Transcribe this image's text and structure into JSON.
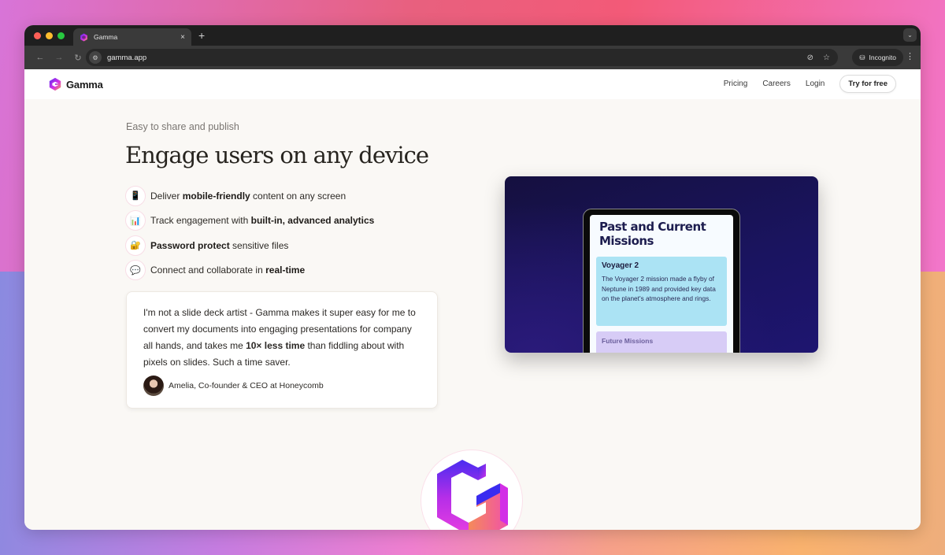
{
  "browser": {
    "tab": {
      "title": "Gamma",
      "favicon": "gamma-logo-icon",
      "close_icon": "×"
    },
    "new_tab_icon": "+",
    "tab_menu_icon": "⌄",
    "nav": {
      "back_icon": "←",
      "forward_icon": "→",
      "reload_icon": "↻"
    },
    "address": {
      "site_info_icon": "⚙",
      "url": "gamma.app"
    },
    "omnibox_icons": {
      "eye_off": "⊘",
      "bookmark": "☆"
    },
    "incognito": {
      "icon": "⛁",
      "label": "Incognito"
    },
    "menu_icon": "⋮"
  },
  "site": {
    "brand": "Gamma",
    "nav_links": [
      "Pricing",
      "Careers",
      "Login"
    ],
    "cta": "Try for free"
  },
  "hero": {
    "eyebrow": "Easy to share and publish",
    "headline": "Engage users on any device",
    "features": [
      {
        "icon": "📱",
        "icon_name": "mobile-phone-icon",
        "pre": "Deliver ",
        "bold": "mobile-friendly",
        "post": " content on any screen"
      },
      {
        "icon": "📊",
        "icon_name": "bar-chart-icon",
        "pre": "Track engagement with ",
        "bold": "built-in, advanced analytics",
        "post": ""
      },
      {
        "icon": "🔐",
        "icon_name": "lock-icon",
        "pre": "",
        "bold": "Password protect",
        "post": " sensitive files"
      },
      {
        "icon": "💬",
        "icon_name": "speech-bubble-icon",
        "pre": "Connect and collaborate in ",
        "bold": "real-time",
        "post": ""
      }
    ]
  },
  "testimonial": {
    "pre": "I'm not a slide deck artist - Gamma makes it super easy for me to convert my documents into engaging presentations for company all hands, and takes me ",
    "bold": "10× less time",
    "post": " than fiddling about with pixels on slides. Such a time saver.",
    "author": "Amelia, Co-founder & CEO at Honeycomb"
  },
  "preview": {
    "title": "Past and Current Missions",
    "card1": {
      "title": "Voyager 2",
      "body": "The Voyager 2 mission made a flyby of Neptune in 1989 and provided key data on the planet's atmosphere and rings."
    },
    "card2": {
      "title": "Future Missions"
    }
  },
  "colors": {
    "page_bg": "#faf8f5",
    "preview_bg": "#15103f",
    "card1_bg": "#abe3f4",
    "card2_bg": "#d7ccf6",
    "brand_gradient": [
      "#6a2cf0",
      "#d42fe6",
      "#f6a14a"
    ]
  }
}
